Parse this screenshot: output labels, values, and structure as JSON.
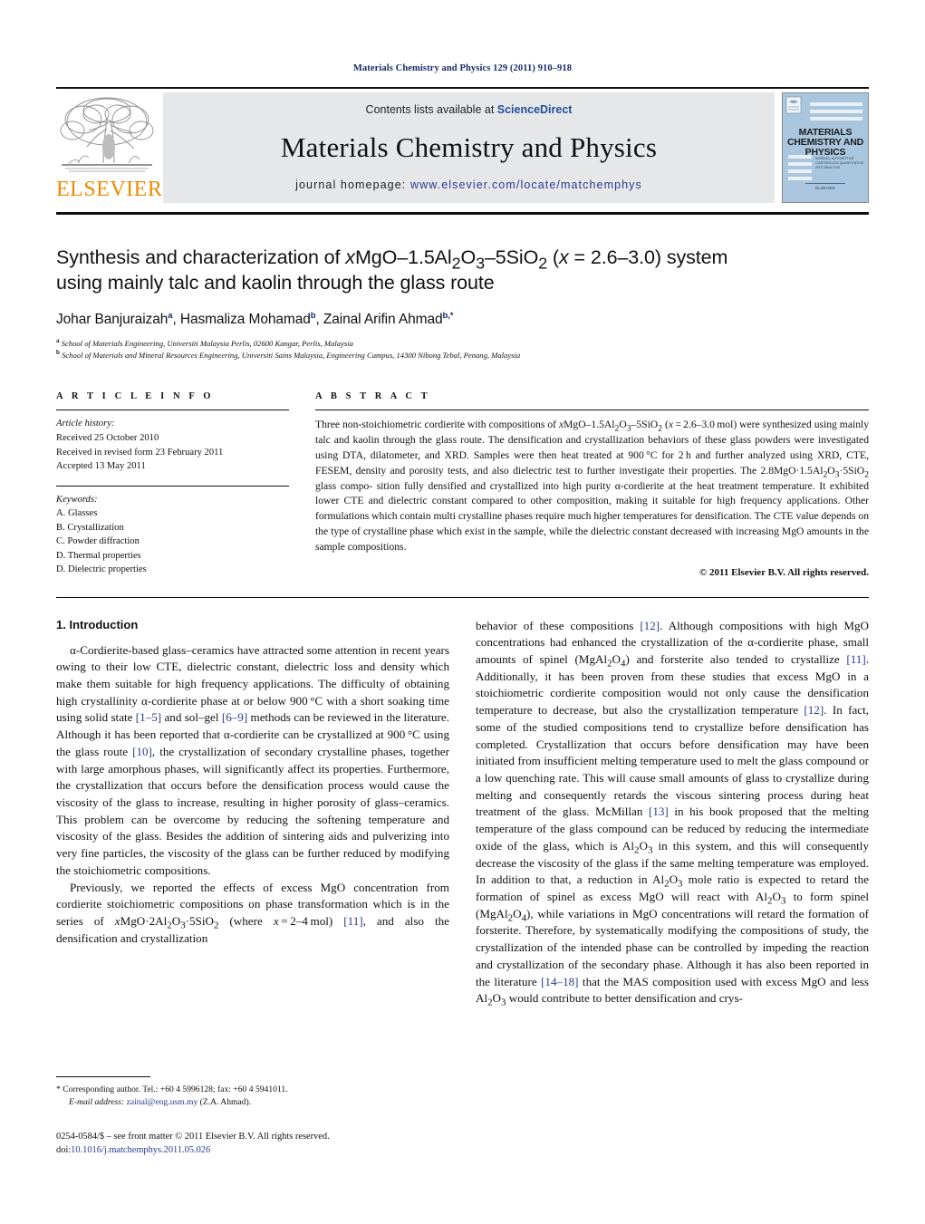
{
  "running_head": "Materials Chemistry and Physics 129 (2011) 910–918",
  "masthead": {
    "publisher_name": "ELSEVIER",
    "contents_prefix": "Contents lists available at ",
    "contents_link": "ScienceDirect",
    "journal_name": "Materials Chemistry and Physics",
    "homepage_prefix": "journal homepage: ",
    "homepage_url": "www.elsevier.com/locate/matchemphys",
    "cover": {
      "line1": "MATERIALS",
      "line2": "CHEMISTRY AND",
      "line3": "PHYSICS",
      "sub_block": "MARKAD, AUTOMOTIVE\\nCONTROLLED QUANTITATIVE SITE",
      "footer_logo": "ELSEVIER"
    }
  },
  "article": {
    "title_line1": "Synthesis and characterization of xMgO–1.5Al2O3–5SiO2 (x = 2.6–3.0) system",
    "title_line2": "using mainly talc and kaolin through the glass route",
    "authors_plain": "Johar Banjuraizah a, Hasmaliza Mohamad b, Zainal Arifin Ahmad b,*",
    "affiliation_a": "School of Materials Engineering, Universiti Malaysia Perlis, 02600 Kangar, Perlis, Malaysia",
    "affiliation_b": "School of Materials and Mineral Resources Engineering, Universiti Sains Malaysia, Engineering Campus, 14300 Nibong Tebal, Penang, Malaysia"
  },
  "article_info": {
    "label": "A R T I C L E   I N F O",
    "history_head": "Article history:",
    "history": [
      "Received 25 October 2010",
      "Received in revised form 23 February 2011",
      "Accepted 13 May 2011"
    ],
    "keywords_head": "Keywords:",
    "keywords": [
      "A. Glasses",
      "B. Crystallization",
      "C. Powder diffraction",
      "D. Thermal properties",
      "D. Dielectric properties"
    ]
  },
  "abstract": {
    "label": "A B S T R A C T",
    "copyright": "© 2011 Elsevier B.V. All rights reserved."
  },
  "introduction": {
    "heading": "1.  Introduction"
  },
  "footnote": {
    "star": "*",
    "corresponding": " Corresponding author. Tel.: +60 4 5996128; fax: +60 4 5941011.",
    "email_label": "E-mail address:",
    "email": "zainal@eng.usm.my",
    "email_owner": " (Z.A. Ahmad).",
    "imprint": "0254-0584/$ – see front matter © 2011 Elsevier B.V. All rights reserved.",
    "doi_label": "doi:",
    "doi": "10.1016/j.matchemphys.2011.05.026"
  },
  "colors": {
    "link": "#2b3a8f",
    "running_head": "#1a2a6c",
    "elsevier_orange": "#ED8B00",
    "banner_gray": "#e6e7e8",
    "cover_blue": "#a9c6de"
  }
}
